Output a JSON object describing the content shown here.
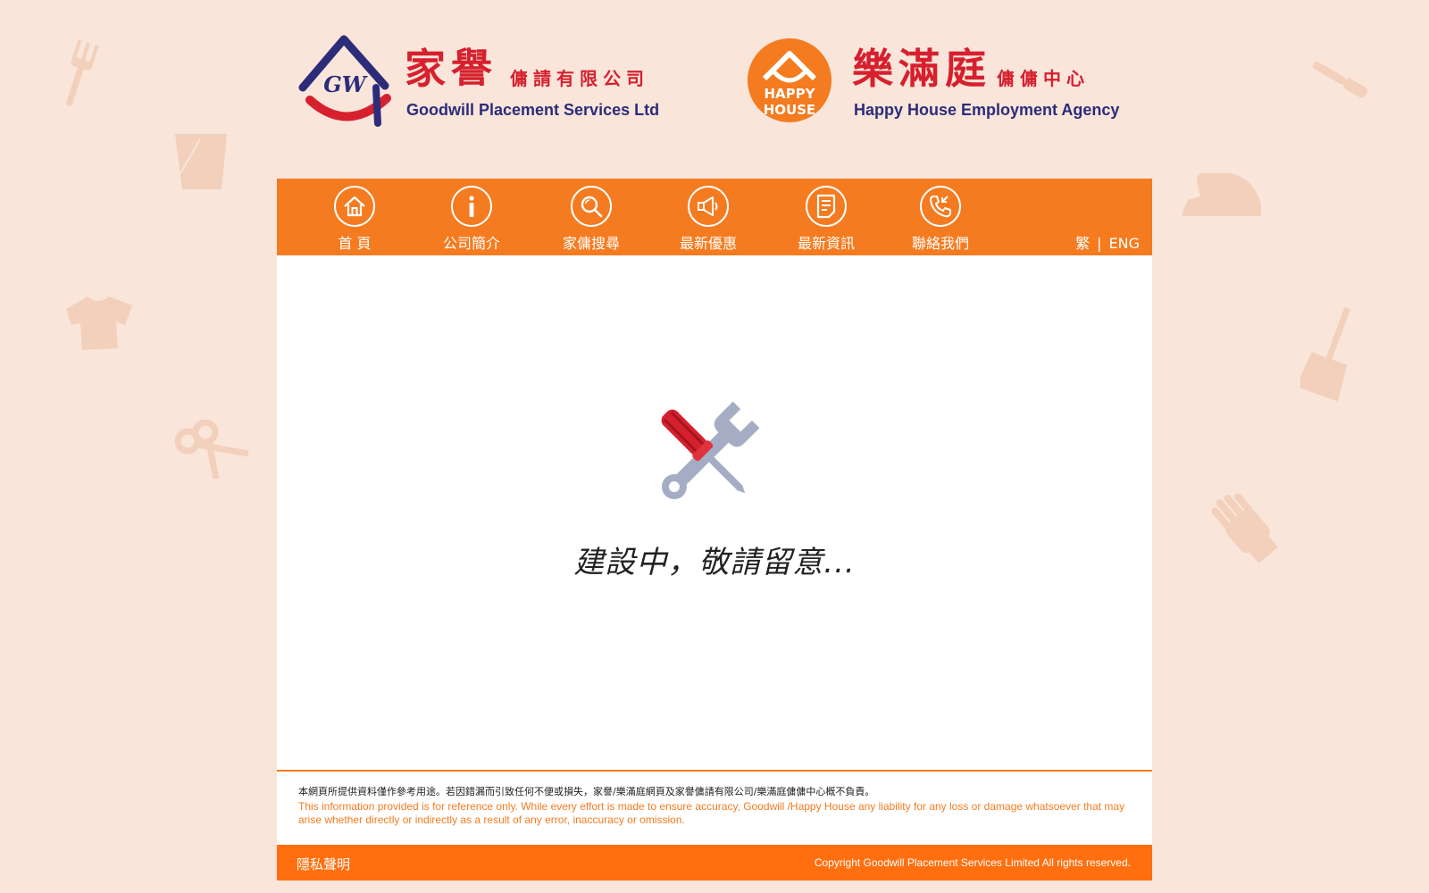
{
  "header": {
    "goodwill": {
      "logo_initials": "GW",
      "name_cn": "家譽",
      "sub_cn": "傭請有限公司",
      "name_en": "Goodwill Placement Services Ltd"
    },
    "happy_house": {
      "logo_line1": "HAPPY",
      "logo_line2": "HOUSE",
      "name_cn": "樂滿庭",
      "sub_cn": "傭傭中心",
      "name_en": "Happy House Employment Agency"
    }
  },
  "nav": {
    "items": [
      {
        "label": "首 頁",
        "icon": "home-icon"
      },
      {
        "label": "公司簡介",
        "icon": "info-icon"
      },
      {
        "label": "家傭搜尋",
        "icon": "search-icon"
      },
      {
        "label": "最新優惠",
        "icon": "megaphone-icon"
      },
      {
        "label": "最新資訊",
        "icon": "news-icon"
      },
      {
        "label": "聯絡我們",
        "icon": "phone-icon"
      }
    ],
    "lang_tc": "繁",
    "lang_sep": "|",
    "lang_en": "ENG"
  },
  "content": {
    "icon": "tools-icon",
    "message": "建設中，敬請留意..."
  },
  "disclaimer": {
    "cn": "本網頁所提供資料僅作參考用途。若因錯漏而引致任何不便或損失，家譽/樂滿庭網頁及家譽傭請有限公司/樂滿庭傭傭中心概不負責。",
    "en": "This information provided is for reference only. While every effort is made to ensure accuracy, Goodwill /Happy House any liability for any loss or damage whatsoever that may arise whether directly or indirectly as a result of any error, inaccuracy or omission."
  },
  "footer": {
    "privacy": "隱私聲明",
    "copyright": "Copyright Goodwill Placement Services Limited All rights reserved."
  },
  "colors": {
    "page_bg": "#f9e5da",
    "nav_orange": "#f47b20",
    "footer_orange": "#ff6f10",
    "brand_red": "#d6202e",
    "brand_navy": "#2c2c7a"
  }
}
